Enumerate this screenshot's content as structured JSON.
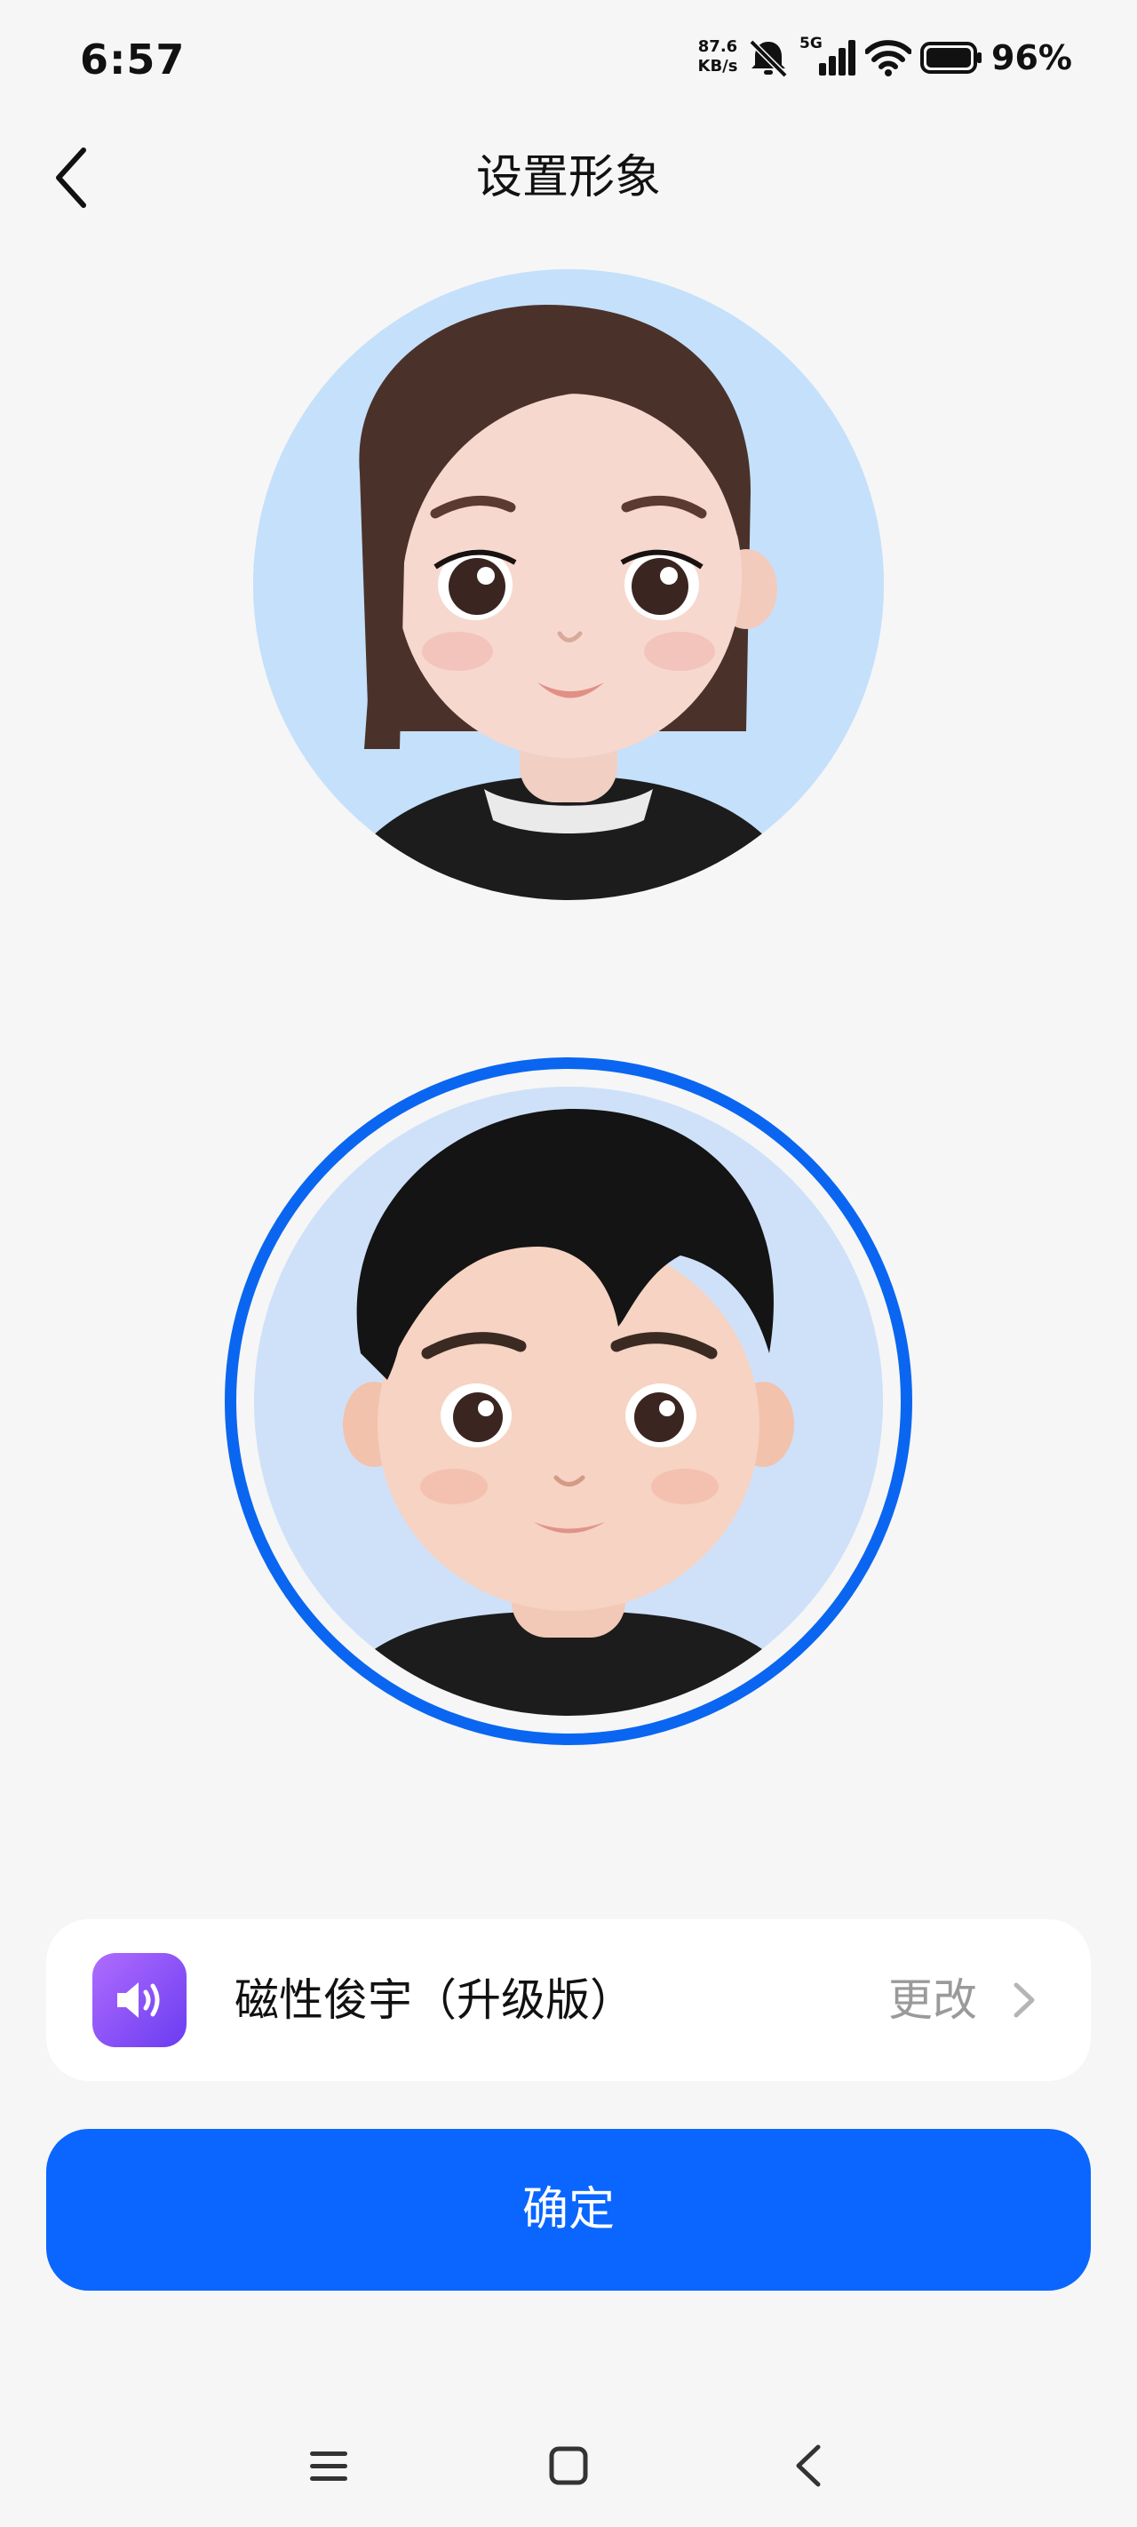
{
  "status_bar": {
    "time": "6:57",
    "net_speed_value": "87.6",
    "net_speed_unit": "KB/s",
    "network_type": "5G",
    "battery": "96%",
    "icons": [
      "mute-icon",
      "signal-icon",
      "wifi-icon",
      "battery-icon"
    ]
  },
  "header": {
    "title": "设置形象",
    "back_icon": "chevron-left-icon"
  },
  "avatars": {
    "options": [
      {
        "name": "female-avatar",
        "selected": false
      },
      {
        "name": "male-avatar",
        "selected": true
      }
    ],
    "selection_color": "#0a66f0"
  },
  "voice": {
    "icon": "speaker-icon",
    "name": "磁性俊宇（升级版）",
    "change_label": "更改",
    "chevron": "chevron-right-icon"
  },
  "confirm": {
    "label": "确定",
    "color": "#0a66ff"
  },
  "nav_bar": {
    "icons": [
      "menu-icon",
      "home-icon",
      "back-icon"
    ]
  }
}
